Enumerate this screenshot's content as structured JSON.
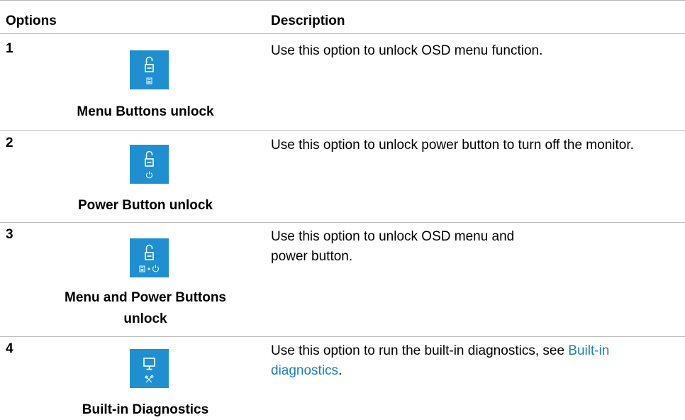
{
  "header": {
    "options": "Options",
    "description": "Description"
  },
  "rows": [
    {
      "number": "1",
      "icon": "lock-open-menu-icon",
      "caption": "Menu Buttons unlock",
      "description": "Use this option to unlock OSD menu function."
    },
    {
      "number": "2",
      "icon": "lock-open-power-icon",
      "caption": "Power Button unlock",
      "description": "Use this option to unlock power button to turn off the monitor."
    },
    {
      "number": "3",
      "icon": "lock-open-menu-power-icon",
      "caption_line1": "Menu and Power Buttons",
      "caption_line2": "unlock",
      "description": "Use this option to unlock OSD menu and power button."
    },
    {
      "number": "4",
      "icon": "monitor-tools-icon",
      "caption": "Built-in Diagnostics",
      "description_prefix": "Use this option to run the built-in diagnostics, see ",
      "description_link": "Built-in diagnostics",
      "description_suffix": "."
    }
  ],
  "colors": {
    "icon_bg": "#1f8fd0",
    "link": "#1a7fc1",
    "rule": "#b9b9b9"
  }
}
